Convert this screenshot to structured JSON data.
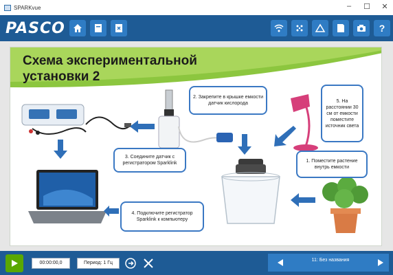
{
  "window": {
    "title": "SPARKvue"
  },
  "brand": {
    "logo_text": "PASCO"
  },
  "toolbar": {
    "left_buttons": [
      "home-icon",
      "document-icon",
      "close-doc-icon"
    ],
    "right_buttons": [
      "wifi-icon",
      "sensors-icon",
      "graph-tools-icon",
      "journal-icon",
      "camera-icon",
      "help-icon"
    ],
    "help_label": "?"
  },
  "slide": {
    "title": "Схема экспериментальной установки 2",
    "callouts": {
      "step1": "1. Поместите растение внутрь емкости",
      "step2": "2. Закрепите в крышке емкости датчик кислорода",
      "step3": "3. Соедините датчик с регистратором Sparklink",
      "step4": "4. Подключите регистратор Sparklink к компьютеру",
      "step5": "5. На расстоянии 30 см от емкости поместите источник света"
    }
  },
  "bottombar": {
    "time": "00:00:00,0",
    "period": "Период: 1 Гц",
    "page_label": "11: Без названия"
  },
  "colors": {
    "toolbar": "#1e5b95",
    "button": "#2f7cc4",
    "play": "#5aa800",
    "banner": "#8cc63f",
    "callout_border": "#3a78c3",
    "arrow": "#2f6fb8"
  }
}
